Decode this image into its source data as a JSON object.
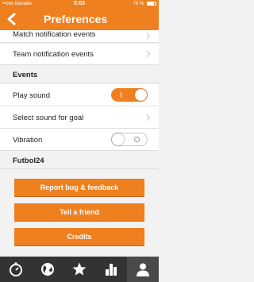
{
  "status": {
    "carrier": "••ооо Билайн",
    "time": "0:03",
    "battery": "78 %"
  },
  "nav": {
    "title": "Preferences"
  },
  "rows_top": [
    {
      "label": "Match notification events"
    },
    {
      "label": "Team notification events"
    }
  ],
  "sections": {
    "events": "Events",
    "futbol24": "Futbol24"
  },
  "events": {
    "play_sound": {
      "label": "Play sound",
      "state": "on"
    },
    "select_sound": {
      "label": "Select sound for goal"
    },
    "vibration": {
      "label": "Vibration",
      "state": "off"
    }
  },
  "buttons": {
    "report": "Report bug & feedback",
    "tell": "Tell a friend",
    "credits": "Credits"
  },
  "tabs": [
    {
      "icon": "stopwatch-icon",
      "active": false
    },
    {
      "icon": "globe-icon",
      "active": false
    },
    {
      "icon": "star-icon",
      "active": false
    },
    {
      "icon": "stats-icon",
      "active": false
    },
    {
      "icon": "user-icon",
      "active": true
    }
  ],
  "colors": {
    "accent": "#ef8020",
    "tabbar": "#333333"
  }
}
